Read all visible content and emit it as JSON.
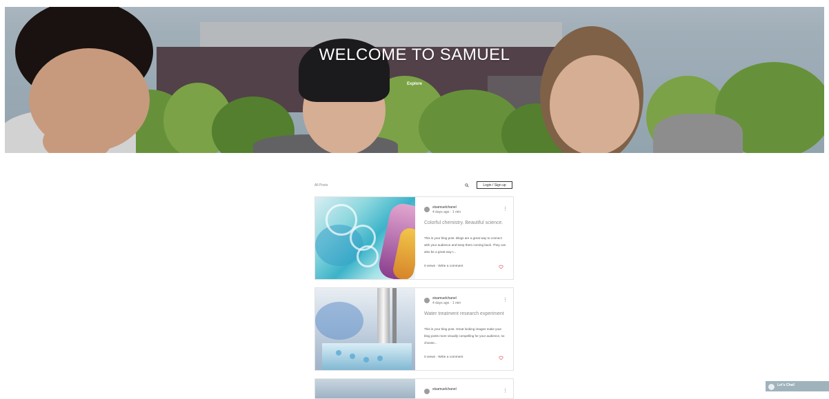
{
  "hero": {
    "title": "WELCOME TO SAMUEL",
    "link": "Explore"
  },
  "toolbar": {
    "all_posts": "All Posts",
    "search_icon": "search-icon",
    "login_label": "Login / Sign up"
  },
  "posts": [
    {
      "author": "stsamuelchanel",
      "meta": "4 days ago · 1 min",
      "title": "Colorful chemistry. Beautiful science.",
      "excerpt": "This is your blog post. Blogs are a great way to connect with your audience and keep them coming back. They can also be a great way t...",
      "stats": "0 views · Write a comment"
    },
    {
      "author": "stsamuelchanel",
      "meta": "4 days ago · 1 min",
      "title": "Water treatment research experiment",
      "excerpt": "This is your blog post. Great looking images make your blog posts more visually compelling for your audience, so choose...",
      "stats": "0 views · Write a comment"
    },
    {
      "author": "stsamuelchanel"
    }
  ],
  "chat": {
    "label": "Let's Chat!"
  },
  "colors": {
    "accent_heart": "#e06a6a",
    "chat_bg": "#9fb3bc"
  }
}
